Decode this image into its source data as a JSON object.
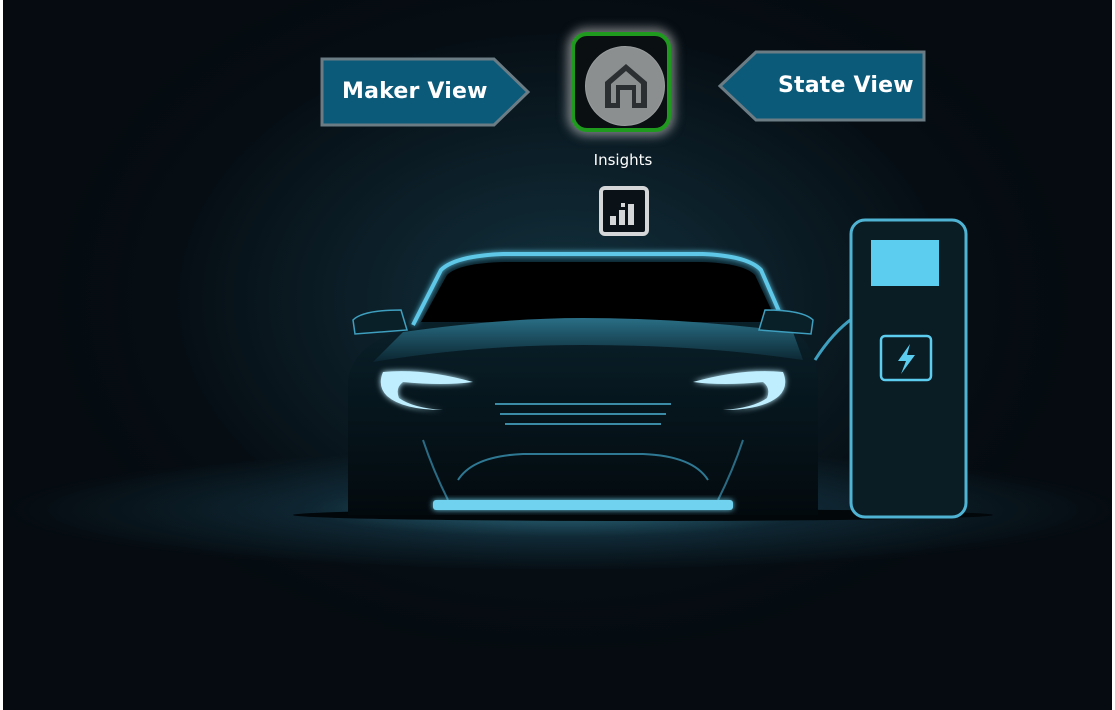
{
  "nav": {
    "maker_view_label": "Maker View",
    "state_view_label": "State View",
    "home_icon": "home-icon",
    "insights_label": "Insights",
    "insights_icon": "bar-chart-icon"
  },
  "colors": {
    "arrow_fill": "#0b5a7a",
    "arrow_border": "#6b7c84",
    "home_border": "#1f9a1f",
    "home_circle": "#8c8f90",
    "background": "#050b10",
    "glow": "#5ec8e8"
  }
}
